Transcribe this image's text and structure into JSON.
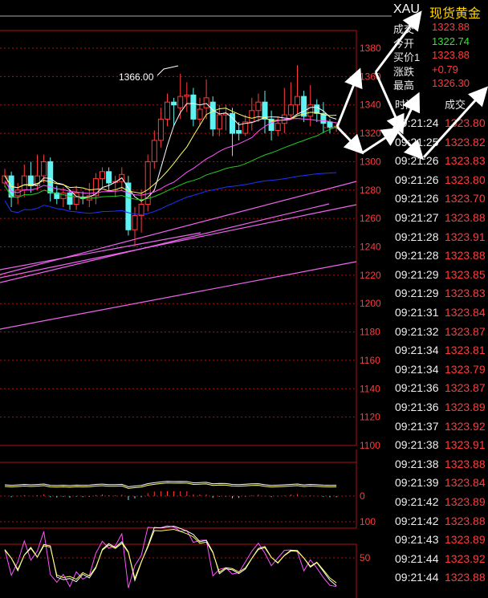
{
  "quote": {
    "symbol": "XAU",
    "name": "现货黄金",
    "rows": [
      {
        "key": "成交",
        "value": "1323.88",
        "color": "#ff3b3b"
      },
      {
        "key": "今开",
        "value": "1322.74",
        "color": "#2ee62e"
      },
      {
        "key": "买价1",
        "value": "1323.88",
        "color": "#ff3b3b"
      },
      {
        "key": "涨跌",
        "value": "+0.79",
        "color": "#ff3b3b"
      },
      {
        "key": "最高",
        "value": "1326.30",
        "color": "#ff3b3b"
      }
    ]
  },
  "ticks": {
    "header_time": "时间",
    "header_price": "成交",
    "rows": [
      {
        "time": "09:21:24",
        "price": "1323.80"
      },
      {
        "time": "09:21:25",
        "price": "1323.82"
      },
      {
        "time": "09:21:26",
        "price": "1323.83"
      },
      {
        "time": "09:21:26",
        "price": "1323.80"
      },
      {
        "time": "09:21:26",
        "price": "1323.70"
      },
      {
        "time": "09:21:27",
        "price": "1323.88"
      },
      {
        "time": "09:21:28",
        "price": "1323.91"
      },
      {
        "time": "09:21:28",
        "price": "1323.88"
      },
      {
        "time": "09:21:29",
        "price": "1323.85"
      },
      {
        "time": "09:21:29",
        "price": "1323.83"
      },
      {
        "time": "09:21:31",
        "price": "1323.84"
      },
      {
        "time": "09:21:32",
        "price": "1323.87"
      },
      {
        "time": "09:21:34",
        "price": "1323.81"
      },
      {
        "time": "09:21:34",
        "price": "1323.79"
      },
      {
        "time": "09:21:36",
        "price": "1323.87"
      },
      {
        "time": "09:21:36",
        "price": "1323.89"
      },
      {
        "time": "09:21:37",
        "price": "1323.92"
      },
      {
        "time": "09:21:38",
        "price": "1323.91"
      },
      {
        "time": "09:21:38",
        "price": "1323.88"
      },
      {
        "time": "09:21:39",
        "price": "1323.84"
      },
      {
        "time": "09:21:42",
        "price": "1323.89"
      },
      {
        "time": "09:21:42",
        "price": "1323.88"
      },
      {
        "time": "09:21:43",
        "price": "1323.89"
      },
      {
        "time": "09:21:44",
        "price": "1323.92"
      },
      {
        "time": "09:21:44",
        "price": "1323.88"
      }
    ]
  },
  "colors": {
    "up": "#ff3b3b",
    "down": "#5ef2f2",
    "frame": "#b01010",
    "ma5": "#ffffff",
    "ma10": "#ffff66",
    "ma20": "#ff55ff",
    "ma30": "#22cc22",
    "ma60": "#2233ff",
    "trend": "#ee66ee"
  },
  "chart_data": {
    "type": "candlestick",
    "price_axis": {
      "ylim": [
        1100,
        1380
      ],
      "ticks": [
        "1380",
        "1360",
        "1340",
        "1320",
        "1300",
        "1280",
        "1260",
        "1240",
        "1220",
        "1200",
        "1180",
        "1160",
        "1140",
        "1120",
        "1100"
      ]
    },
    "annotation": "1366.00",
    "candles": [
      [
        1285,
        1290,
        1282,
        1295
      ],
      [
        1290,
        1275,
        1268,
        1293
      ],
      [
        1276,
        1280,
        1270,
        1285
      ],
      [
        1280,
        1290,
        1275,
        1298
      ],
      [
        1290,
        1283,
        1278,
        1300
      ],
      [
        1283,
        1290,
        1280,
        1305
      ],
      [
        1290,
        1300,
        1285,
        1305
      ],
      [
        1300,
        1278,
        1272,
        1303
      ],
      [
        1278,
        1274,
        1270,
        1283
      ],
      [
        1274,
        1278,
        1268,
        1282
      ],
      [
        1278,
        1270,
        1266,
        1280
      ],
      [
        1270,
        1278,
        1266,
        1283
      ],
      [
        1275,
        1274,
        1270,
        1279
      ],
      [
        1273,
        1276,
        1268,
        1285
      ],
      [
        1276,
        1288,
        1270,
        1292
      ],
      [
        1288,
        1293,
        1282,
        1296
      ],
      [
        1293,
        1285,
        1280,
        1296
      ],
      [
        1286,
        1286,
        1275,
        1290
      ],
      [
        1286,
        1291,
        1280,
        1296
      ],
      [
        1285,
        1252,
        1248,
        1290
      ],
      [
        1252,
        1262,
        1240,
        1268
      ],
      [
        1262,
        1270,
        1250,
        1280
      ],
      [
        1270,
        1300,
        1265,
        1305
      ],
      [
        1300,
        1315,
        1295,
        1322
      ],
      [
        1315,
        1330,
        1310,
        1338
      ],
      [
        1330,
        1342,
        1325,
        1348
      ],
      [
        1342,
        1340,
        1325,
        1345
      ],
      [
        1338,
        1346,
        1330,
        1362
      ],
      [
        1346,
        1347,
        1335,
        1356
      ],
      [
        1347,
        1330,
        1325,
        1352
      ],
      [
        1330,
        1337,
        1325,
        1345
      ],
      [
        1338,
        1345,
        1330,
        1358
      ],
      [
        1342,
        1323,
        1318,
        1346
      ],
      [
        1323,
        1333,
        1318,
        1340
      ],
      [
        1333,
        1334,
        1322,
        1340
      ],
      [
        1334,
        1320,
        1304,
        1338
      ],
      [
        1322,
        1320,
        1315,
        1328
      ],
      [
        1320,
        1328,
        1318,
        1333
      ],
      [
        1328,
        1336,
        1322,
        1345
      ],
      [
        1336,
        1342,
        1328,
        1348
      ],
      [
        1342,
        1330,
        1320,
        1350
      ],
      [
        1330,
        1322,
        1315,
        1336
      ],
      [
        1322,
        1327,
        1318,
        1332
      ],
      [
        1327,
        1333,
        1320,
        1352
      ],
      [
        1333,
        1340,
        1330,
        1356
      ],
      [
        1340,
        1346,
        1334,
        1368
      ],
      [
        1346,
        1332,
        1328,
        1350
      ],
      [
        1332,
        1340,
        1325,
        1354
      ],
      [
        1340,
        1334,
        1328,
        1344
      ],
      [
        1334,
        1327,
        1320,
        1342
      ],
      [
        1328,
        1324,
        1320,
        1330
      ],
      [
        1324,
        1325,
        1321,
        1328
      ]
    ],
    "macd": {
      "ylim": [
        -2,
        2
      ],
      "zero_label": "0"
    },
    "kdj": {
      "ylim": [
        0,
        120
      ],
      "ticks": [
        "100",
        "50"
      ]
    }
  }
}
